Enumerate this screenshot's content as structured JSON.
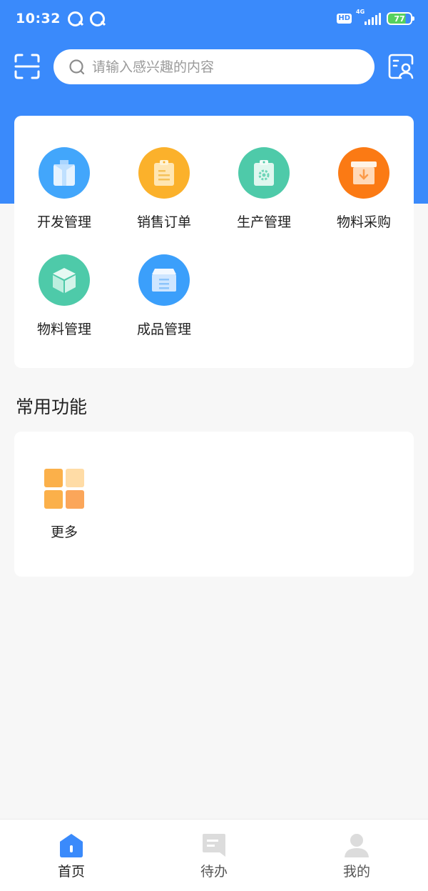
{
  "status_bar": {
    "time": "10:32",
    "hd": "HD",
    "network": "4G",
    "battery": "77",
    "battery_level": 77
  },
  "header": {
    "search_placeholder": "请输入感兴趣的内容",
    "scan_icon": "scan-icon",
    "contact_icon": "contact-card-icon"
  },
  "menu": {
    "items": [
      {
        "label": "开发管理",
        "icon": "shirt-icon",
        "color": "#42a6fb"
      },
      {
        "label": "销售订单",
        "icon": "clipboard-icon",
        "color": "#fbb12b"
      },
      {
        "label": "生产管理",
        "icon": "gear-clipboard-icon",
        "color": "#4ecaa9"
      },
      {
        "label": "物料采购",
        "icon": "inbox-download-icon",
        "color": "#fb7a14"
      },
      {
        "label": "物料管理",
        "icon": "cube-icon",
        "color": "#4ecaa9"
      },
      {
        "label": "成品管理",
        "icon": "box-list-icon",
        "color": "#3b9ffb"
      }
    ]
  },
  "common": {
    "title": "常用功能",
    "more_label": "更多",
    "more_icon": "grid-icon"
  },
  "bottom_nav": {
    "items": [
      {
        "label": "首页",
        "icon": "home-icon",
        "active": true
      },
      {
        "label": "待办",
        "icon": "message-icon",
        "active": false
      },
      {
        "label": "我的",
        "icon": "user-icon",
        "active": false
      }
    ],
    "active_color": "#3a8afb",
    "inactive_color": "#666666"
  }
}
